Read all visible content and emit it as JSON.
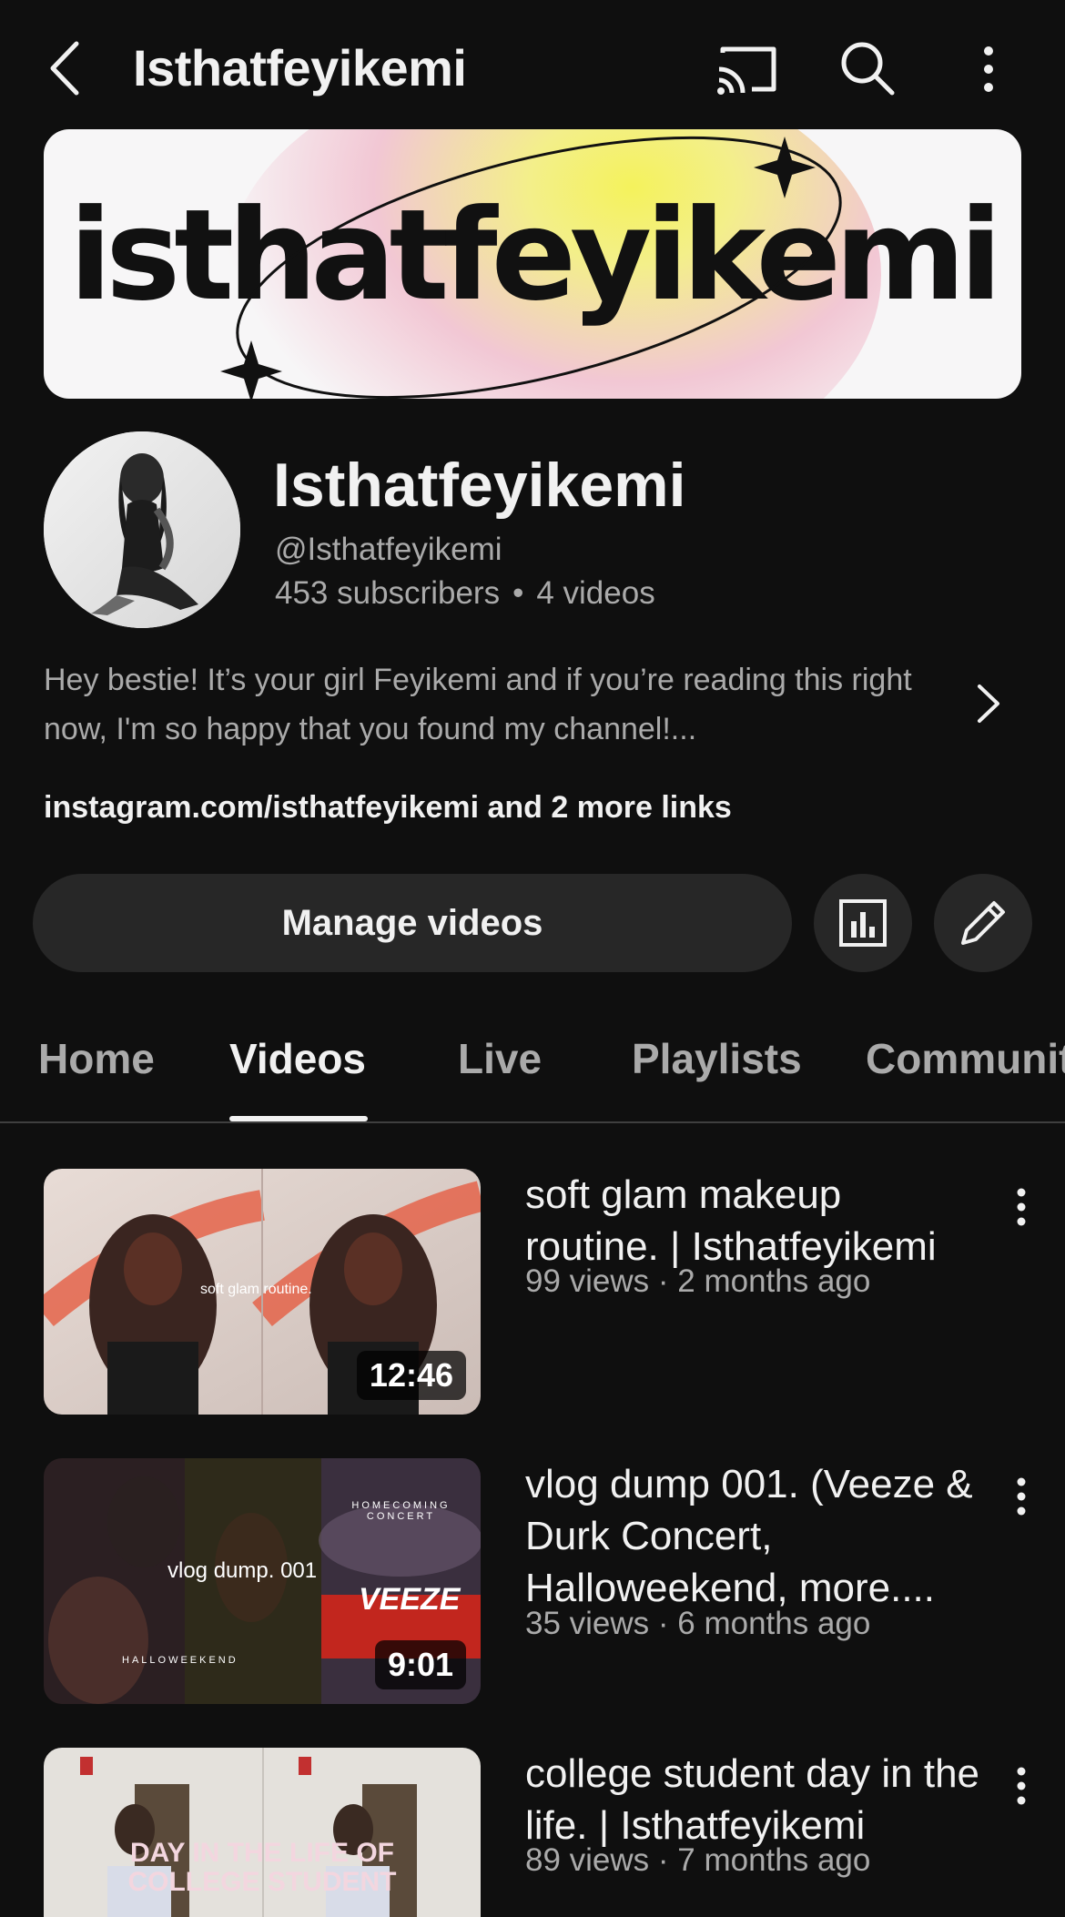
{
  "header": {
    "title": "Isthatfeyikemi",
    "icons": [
      "back-arrow-icon",
      "cast-icon",
      "search-icon",
      "more-vert-icon"
    ]
  },
  "banner": {
    "text": "isthatfeyikemi"
  },
  "channel": {
    "name": "Isthatfeyikemi",
    "handle": "@Isthatfeyikemi",
    "subscribers": "453 subscribers",
    "separator": "•",
    "videos": "4 videos",
    "description": "Hey bestie! It’s your girl Feyikemi and if you’re reading this right now, I'm so happy that you found my channel!...",
    "links": "instagram.com/isthatfeyikemi and 2 more links"
  },
  "actions": {
    "manage_label": "Manage videos"
  },
  "tabs": [
    {
      "label": "Home",
      "active": false
    },
    {
      "label": "Videos",
      "active": true
    },
    {
      "label": "Live",
      "active": false
    },
    {
      "label": "Playlists",
      "active": false
    },
    {
      "label": "Community",
      "active": false
    }
  ],
  "videos": [
    {
      "title": "soft glam makeup routine. | Isthatfeyikemi",
      "meta": "99 views · 2 months ago",
      "duration": "12:46",
      "thumb_text": "soft glam routine."
    },
    {
      "title": "vlog dump 001. (Veeze & Durk Concert, Halloweekend, more....",
      "meta": "35 views · 6 months ago",
      "duration": "9:01",
      "thumb_text": "vlog dump. 001",
      "thumb_text_2": "HOMECOMING CONCERT",
      "thumb_text_3": "HALLOWEEKEND",
      "thumb_text_4": "VEEZE"
    },
    {
      "title": "college student day in the life. | Isthatfeyikemi",
      "meta": "89 views · 7 months ago",
      "thumb_text": "DAY IN THE LIFE OF COLLEGE STUDENT"
    }
  ],
  "colors": {
    "background": "#0f0f0f",
    "surface": "#272727",
    "text_primary": "#f1f1f1",
    "text_secondary": "#aaaaaa"
  }
}
